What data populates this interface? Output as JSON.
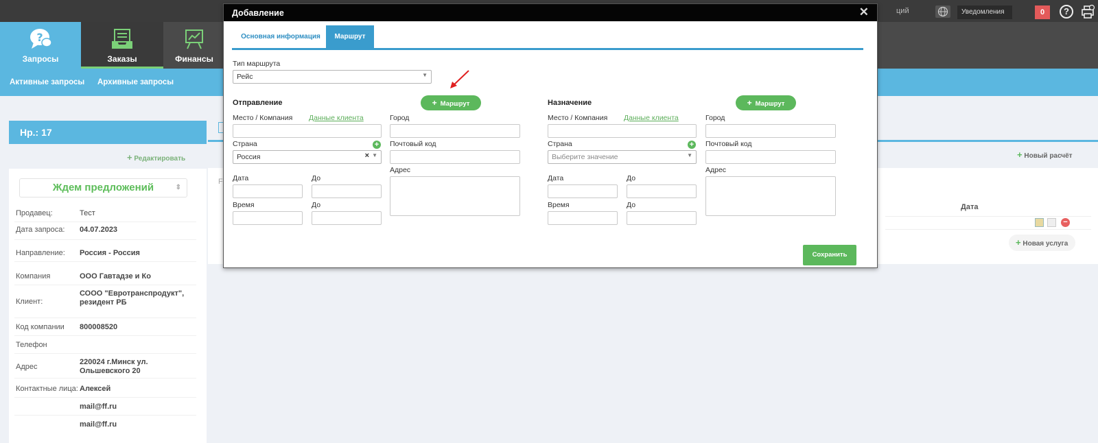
{
  "topbar": {
    "fragment": "ций",
    "notifications_label": "Уведомления",
    "notifications_count": "0"
  },
  "nav": {
    "items": [
      {
        "label": "Запросы",
        "icon": "chat-question-icon"
      },
      {
        "label": "Заказы",
        "icon": "inbox-icon"
      },
      {
        "label": "Финансы",
        "icon": "presentation-chart-icon"
      }
    ],
    "sub": [
      "Активные запросы",
      "Архивные запросы"
    ]
  },
  "left": {
    "header": "Нр.: 17",
    "edit_label": "Редактировать",
    "status": "Ждем предложений",
    "rows": [
      {
        "label": "Продавец:",
        "value": "Тест"
      },
      {
        "label": "Дата запроса:",
        "value": "04.07.2023"
      },
      {
        "label": "Направление:",
        "value": "Россия - Россия"
      },
      {
        "label": "Компания",
        "value": "ООО Гавтадзе и Ко"
      },
      {
        "label": "Клиент:",
        "value": "СООО \"Евротранспродукт\", резидент РБ"
      },
      {
        "label": "Код компании",
        "value": "800008520"
      },
      {
        "label": "Телефон",
        "value": ""
      },
      {
        "label": "Адрес",
        "value": "220024 г.Минск ул. Ольшевского 20"
      },
      {
        "label": "Контактные лица:",
        "value": "Алексей"
      },
      {
        "label": "",
        "value": "mail@ff.ru"
      },
      {
        "label": "",
        "value": "mail@ff.ru"
      }
    ]
  },
  "right": {
    "new_calc": "Новый расчёт",
    "date_header": "Дата",
    "new_service": "Новая услуга",
    "fragment": "F"
  },
  "modal": {
    "title": "Добавление",
    "tabs": [
      "Основная информация",
      "Маршрут"
    ],
    "route_type_label": "Тип маршрута",
    "route_type_value": "Рейс",
    "route_button": "Маршрут",
    "save": "Сохранить",
    "departure": {
      "title": "Отправление",
      "place_label": "Место / Компания",
      "client_data_link": "Данные клиента",
      "city_label": "Город",
      "country_label": "Страна",
      "country_value": "Россия",
      "postal_label": "Почтовый код",
      "address_label": "Адрес",
      "date_label": "Дата",
      "to_label": "До",
      "time_label": "Время",
      "to2_label": "До"
    },
    "destination": {
      "title": "Назначение",
      "place_label": "Место / Компания",
      "client_data_link": "Данные клиента",
      "city_label": "Город",
      "country_label": "Страна",
      "country_placeholder": "Выберите значение",
      "postal_label": "Почтовый код",
      "address_label": "Адрес",
      "date_label": "Дата",
      "to_label": "До",
      "time_label": "Время",
      "to2_label": "До"
    }
  },
  "colors": {
    "accent_blue": "#5bb7e0",
    "green": "#5cb85c",
    "dark": "#3b3b3b",
    "annotation_arrow": "#e02020"
  }
}
